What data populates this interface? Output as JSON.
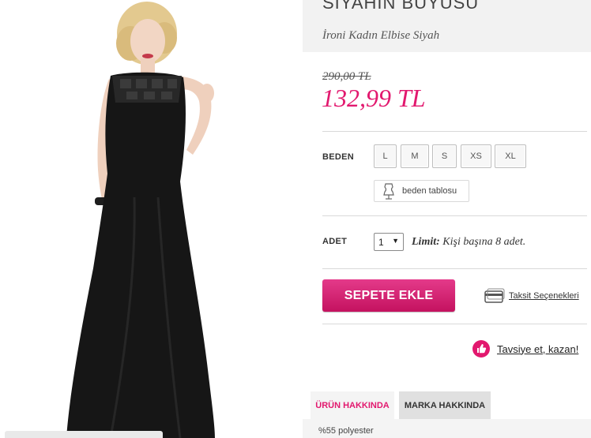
{
  "product": {
    "brand_title": "SIYAHIN BÜYÜSÜ",
    "name": "İroni Kadın Elbise Siyah",
    "old_price": "290,00 TL",
    "new_price": "132,99 TL"
  },
  "size": {
    "label": "BEDEN",
    "options": [
      "L",
      "M",
      "S",
      "XS",
      "XL"
    ],
    "chart_label": "beden tablosu",
    "chart_icon": "dress-form-icon"
  },
  "quantity": {
    "label": "ADET",
    "selected": "1",
    "limit_label": "Limit:",
    "limit_text": " Kişi başına 8 adet."
  },
  "actions": {
    "add_to_cart": "SEPETE EKLE",
    "installments": "Taksit Seçenekleri",
    "installments_icon": "credit-card-icon",
    "recommend": "Tavsiye et, kazan!",
    "recommend_icon": "thumbs-up-icon"
  },
  "tabs": [
    {
      "label": "ÜRÜN HAKKINDA",
      "active": true
    },
    {
      "label": "MARKA HAKKINDA",
      "active": false
    }
  ],
  "tab_content": {
    "first_line": "%55 polyester"
  },
  "colors": {
    "accent": "#e2186e",
    "title_band": "#f2f2f2",
    "dress": "#161616"
  }
}
